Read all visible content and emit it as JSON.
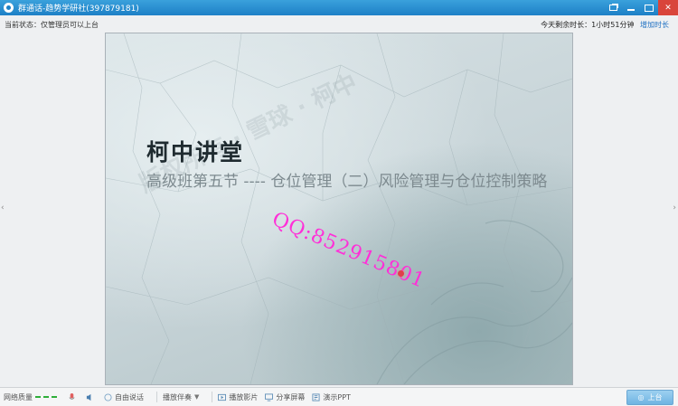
{
  "window": {
    "title": "群通话-趋势学研社(397879181)",
    "buttons": [
      "restore-icon",
      "minimize-icon",
      "maximize-icon",
      "close-icon"
    ]
  },
  "status": {
    "current_state": "当前状态：仅管理员可以上台",
    "remaining_time": "今天剩余时长：1小时51分钟",
    "add_time": "增加时长"
  },
  "slide": {
    "title": "柯中讲堂",
    "subtitle": "高级班第五节 ---- 仓位管理（二）风险管理与仓位控制策略",
    "watermark_qq": "QQ:852915801",
    "background_watermark": "版权所有 · 雪球 · 柯中"
  },
  "toolbar": {
    "network_label": "网络质量",
    "free_talk": "自由说话",
    "play_sound": "播放伴奏",
    "play_video": "播放影片",
    "share_screen": "分享屏幕",
    "present_ppt": "演示PPT",
    "go_up": "上台"
  },
  "colors": {
    "titlebar": "#1d80c6",
    "watermark": "#ff2fd8",
    "network_good": "#2fae3a"
  }
}
